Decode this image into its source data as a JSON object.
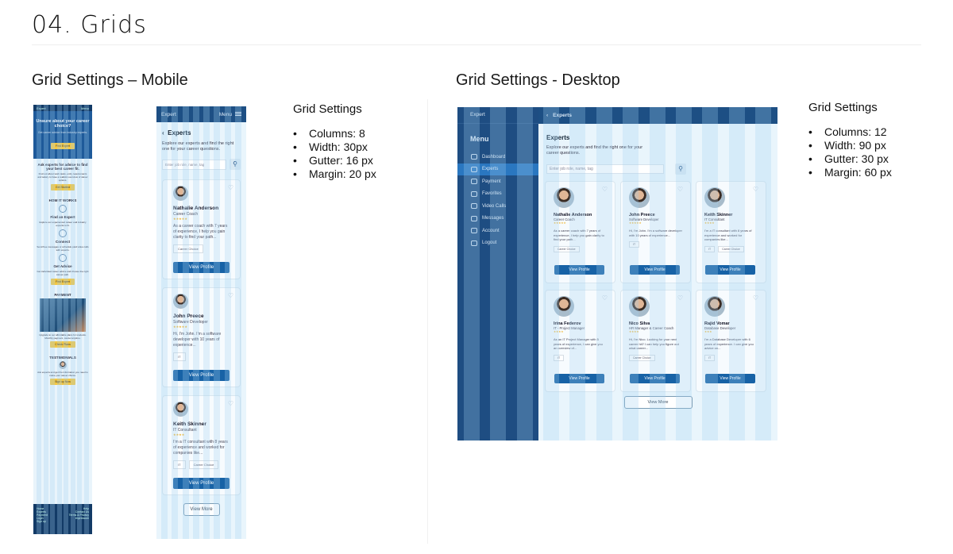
{
  "page": {
    "title": "04. Grids"
  },
  "mobile": {
    "section_title": "Grid Settings – Mobile",
    "settings": {
      "title": "Grid Settings",
      "items": [
        "Columns: 8",
        "Width:   30px",
        "Gutter:  16 px",
        "Margin: 20 px"
      ]
    },
    "landing": {
      "brand": "Expert",
      "menu": "Menu",
      "hero_title": "Unsure about your career choice?",
      "hero_sub": "Get career advice from industry experts.",
      "hero_cta": "Find Expert",
      "ask_title": "Ask experts for advice to find your best career fit.",
      "ask_body": "Find out about work tasks, entry requirements and salary to have a realistic overview of career options.",
      "ask_cta": "Get Started",
      "how_title": "HOW IT WORKS",
      "steps": [
        {
          "title": "Find an Expert",
          "body": "Explore our experienced career and industry experts to fit."
        },
        {
          "title": "Connect",
          "body": "Send free messages or schedule paid video calls with experts."
        },
        {
          "title": "Get Advice",
          "body": "Get individual career advice and choose the right career path."
        }
      ],
      "steps_cta": "Find Expert",
      "payment_title": "PAYMENT",
      "payment_body": "Upgrade to our affordable plans for students. Monthly payment, cancel anytime.",
      "payment_cta": "Check Plans",
      "testimonials_title": "TESTIMONIALS",
      "signup_body": "Ask experts and get the information you need to make your career choice.",
      "signup_cta": "Sign up Now",
      "footer_left": [
        "Home",
        "Experts",
        "Payment",
        "Login",
        "Sign up"
      ],
      "footer_right": [
        "Help",
        "Contact Us",
        "Terms & Privacy",
        "Impressum"
      ]
    },
    "app": {
      "brand": "Expert",
      "menu": "Menu",
      "heading": "Experts",
      "intro": "Explore our experts and find the right one for your career questions.",
      "search_placeholder": "Enter job role, name, tag",
      "view_more": "View More",
      "cards": [
        {
          "name": "Nathalie Anderson",
          "role": "Career Coach",
          "stars": "★★★★★",
          "bio": "As a career coach with 7 years of experience, I help you gain clarity to find your path...",
          "tags": [
            "Career Choice"
          ],
          "button": "View Profile"
        },
        {
          "name": "John Preece",
          "role": "Software Developer",
          "stars": "★★★★★",
          "bio": "Hi, I’m John. I’m a software developer with 10 years of experience...",
          "tags": [
            "IT"
          ],
          "button": "View Profile"
        },
        {
          "name": "Keith Skinner",
          "role": "IT Consultant",
          "stars": "★★★★",
          "bio": "I’m a IT consultant with 8 years of experience and worked for companies like...",
          "tags": [
            "IT",
            "Career Choice"
          ],
          "button": "View Profile"
        }
      ]
    }
  },
  "desktop": {
    "section_title": "Grid Settings -  Desktop",
    "settings": {
      "title": "Grid Settings",
      "items": [
        "Columns: 12",
        "Width:   90 px",
        "Gutter:  30 px",
        "Margin: 60 px"
      ]
    },
    "app": {
      "brand": "Expert",
      "menu_heading": "Menu",
      "menu_items": [
        "Dashboard",
        "Experts",
        "Payment",
        "Favorites",
        "Video Calls",
        "Messages",
        "Account",
        "Logout"
      ],
      "back_label": "Experts",
      "heading": "Experts",
      "intro": "Explore our experts and find the right one for your career questions.",
      "search_placeholder": "Enter job role, name, tag",
      "view_more": "View More",
      "cards": [
        {
          "name": "Nathalie Anderson",
          "role": "Career Coach",
          "stars": "★★★★★",
          "bio": "As a career coach with 7 years of experience, I help you gain clarity to find your path...",
          "tags": [
            "Career Choice"
          ],
          "button": "View Profile"
        },
        {
          "name": "John Preece",
          "role": "Software Developer",
          "stars": "★★★★★",
          "bio": "Hi, I’m John. I’m a software developer with 10 years of experience...",
          "tags": [
            "IT"
          ],
          "button": "View Profile"
        },
        {
          "name": "Keith Skinner",
          "role": "IT Consultant",
          "stars": "★★★★",
          "bio": "I’m a IT consultant with 8 years of experience and worked for companies like...",
          "tags": [
            "IT",
            "Career Choice"
          ],
          "button": "View Profile"
        },
        {
          "name": "Irina Federov",
          "role": "IT - Project Manager",
          "stars": "★★★★",
          "bio": "As an IT Project Manager with 5 years of experience, I can give you an overview of...",
          "tags": [
            "IT"
          ],
          "button": "View Profile"
        },
        {
          "name": "Nico Silva",
          "role": "HR Manager & Career Coach",
          "stars": "★★★★",
          "bio": "Hi, I’m Nico. Looking for your next career hit? I can help you figure out what career...",
          "tags": [
            "Career Choice"
          ],
          "button": "View Profile"
        },
        {
          "name": "Rajid Vomar",
          "role": "Database Developer",
          "stars": "★★★",
          "bio": "I’m a Database Developer with 6 years of experience. I can give you advice on...",
          "tags": [
            "IT"
          ],
          "button": "View Profile"
        }
      ]
    }
  },
  "colors": {
    "primary": "#1d4f84",
    "accent": "#1762a6",
    "grid_overlay": "#a0d2f0",
    "cta_yellow": "#f3c742"
  }
}
